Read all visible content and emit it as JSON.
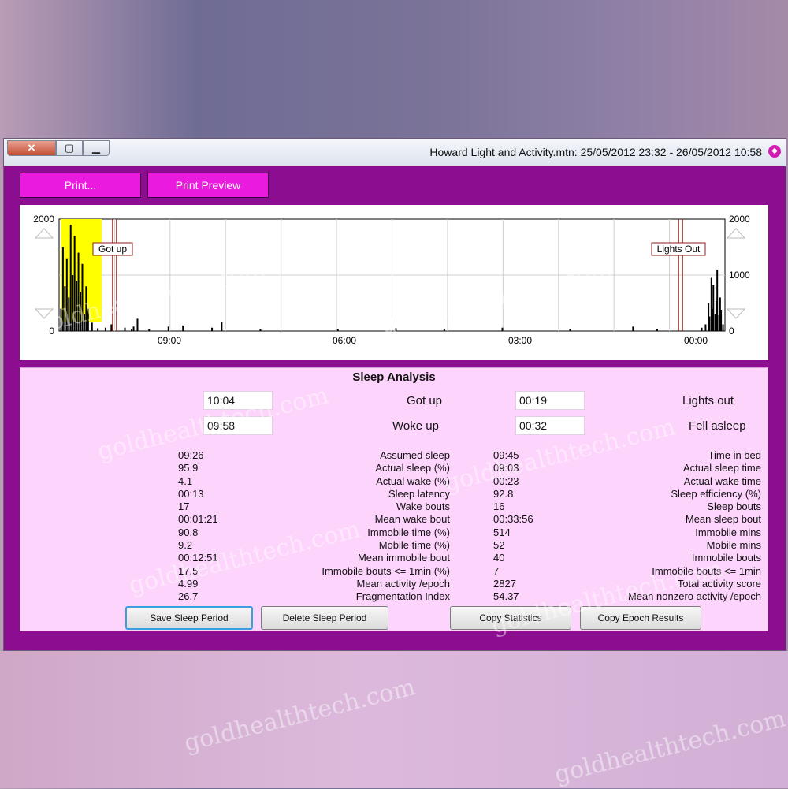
{
  "window": {
    "title": "Howard Light and Activity.mtn: 25/05/2012 23:32 - 26/05/2012 10:58",
    "close_glyph": "✕",
    "max_glyph": "▢",
    "min_glyph": "▁"
  },
  "toolbar": {
    "print_label": "Print...",
    "preview_label": "Print Preview"
  },
  "chart_data": {
    "type": "bar",
    "title": "",
    "x_axis_ticks": [
      "09:00",
      "06:00",
      "03:00",
      "00:00"
    ],
    "y_axis_left_ticks": [
      "2000",
      "0"
    ],
    "y_axis_right_ticks": [
      "2000",
      "1000",
      "0"
    ],
    "ylim": [
      0,
      2000
    ],
    "markers": [
      {
        "label": "Got up",
        "time": "10:04"
      },
      {
        "label": "Lights Out",
        "time": "00:19"
      }
    ],
    "bars": [
      {
        "offset_min": 2,
        "value": 120
      },
      {
        "offset_min": 4,
        "value": 380
      },
      {
        "offset_min": 5,
        "value": 600
      },
      {
        "offset_min": 6,
        "value": 280
      },
      {
        "offset_min": 8,
        "value": 1100
      },
      {
        "offset_min": 9,
        "value": 540
      },
      {
        "offset_min": 10,
        "value": 300
      },
      {
        "offset_min": 12,
        "value": 820
      },
      {
        "offset_min": 13,
        "value": 400
      },
      {
        "offset_min": 14,
        "value": 950
      },
      {
        "offset_min": 16,
        "value": 260
      },
      {
        "offset_min": 17,
        "value": 500
      },
      {
        "offset_min": 20,
        "value": 120
      },
      {
        "offset_min": 24,
        "value": 60
      },
      {
        "offset_min": 70,
        "value": 40
      },
      {
        "offset_min": 95,
        "value": 80
      },
      {
        "offset_min": 160,
        "value": 40
      },
      {
        "offset_min": 230,
        "value": 60
      },
      {
        "offset_min": 290,
        "value": 30
      },
      {
        "offset_min": 340,
        "value": 50
      },
      {
        "offset_min": 400,
        "value": 40
      },
      {
        "offset_min": 480,
        "value": 30
      },
      {
        "offset_min": 520,
        "value": 160
      },
      {
        "offset_min": 530,
        "value": 60
      },
      {
        "offset_min": 560,
        "value": 100
      },
      {
        "offset_min": 575,
        "value": 80
      },
      {
        "offset_min": 595,
        "value": 30
      },
      {
        "offset_min": 607,
        "value": 220
      },
      {
        "offset_min": 611,
        "value": 80
      },
      {
        "offset_min": 613,
        "value": 30
      },
      {
        "offset_min": 620,
        "value": 60
      },
      {
        "offset_min": 634,
        "value": 120
      },
      {
        "offset_min": 640,
        "value": 60
      },
      {
        "offset_min": 648,
        "value": 50
      },
      {
        "offset_min": 654,
        "value": 150
      },
      {
        "offset_min": 658,
        "value": 400
      },
      {
        "offset_min": 660,
        "value": 800
      },
      {
        "offset_min": 662,
        "value": 300
      },
      {
        "offset_min": 664,
        "value": 1200
      },
      {
        "offset_min": 666,
        "value": 700
      },
      {
        "offset_min": 668,
        "value": 1400
      },
      {
        "offset_min": 670,
        "value": 900
      },
      {
        "offset_min": 672,
        "value": 1700
      },
      {
        "offset_min": 674,
        "value": 1000
      },
      {
        "offset_min": 676,
        "value": 1900
      },
      {
        "offset_min": 678,
        "value": 600
      },
      {
        "offset_min": 680,
        "value": 1300
      },
      {
        "offset_min": 682,
        "value": 800
      },
      {
        "offset_min": 684,
        "value": 1500
      },
      {
        "offset_min": 686,
        "value": 400
      }
    ],
    "highlight_regions": [
      {
        "from_min": 0,
        "to_min": 14,
        "kind": "awake-after-lights-out"
      },
      {
        "from_min": 644,
        "to_min": 686,
        "kind": "awake-after-waking",
        "color": "#ffff00"
      }
    ],
    "colors": {
      "bar": "#000000",
      "marker": "#8b1d1d",
      "grid": "#d0d0d0",
      "highlight": "#ffff00"
    }
  },
  "analysis": {
    "title": "Sleep Analysis",
    "lights_out": {
      "label": "Lights out",
      "value": "00:19"
    },
    "got_up": {
      "label": "Got up",
      "value": "10:04"
    },
    "fell_asleep": {
      "label": "Fell asleep",
      "value": "00:32"
    },
    "woke_up": {
      "label": "Woke up",
      "value": "09:58"
    },
    "left_stats": [
      {
        "label": "Time in bed",
        "value": "09:45"
      },
      {
        "label": "Actual sleep time",
        "value": "09:03"
      },
      {
        "label": "Actual wake time",
        "value": "00:23"
      },
      {
        "label": "Sleep efficiency (%)",
        "value": "92.8"
      },
      {
        "label": "Sleep bouts",
        "value": "16"
      },
      {
        "label": "Mean sleep bout",
        "value": "00:33:56"
      },
      {
        "label": "Immobile mins",
        "value": "514"
      },
      {
        "label": "Mobile mins",
        "value": "52"
      },
      {
        "label": "Immobile bouts",
        "value": "40"
      },
      {
        "label": "Immobile bouts <= 1min",
        "value": "7"
      },
      {
        "label": "Total activity score",
        "value": "2827"
      },
      {
        "label": "Mean nonzero activity /epoch",
        "value": "54.37"
      }
    ],
    "right_stats": [
      {
        "label": "Assumed sleep",
        "value": "09:26"
      },
      {
        "label": "Actual sleep (%)",
        "value": "95.9"
      },
      {
        "label": "Actual wake (%)",
        "value": "4.1"
      },
      {
        "label": "Sleep latency",
        "value": "00:13"
      },
      {
        "label": "Wake bouts",
        "value": "17"
      },
      {
        "label": "Mean wake bout",
        "value": "00:01:21"
      },
      {
        "label": "Immobile time (%)",
        "value": "90.8"
      },
      {
        "label": "Mobile time (%)",
        "value": "9.2"
      },
      {
        "label": "Mean immobile bout",
        "value": "00:12:51"
      },
      {
        "label": "Immobile bouts <= 1min (%)",
        "value": "17.5"
      },
      {
        "label": "Mean activity /epoch",
        "value": "4.99"
      },
      {
        "label": "Fragmentation Index",
        "value": "26.7"
      }
    ],
    "buttons": {
      "copy_epoch": "Copy Epoch Results",
      "copy_stats": "Copy Statistics",
      "delete_period": "Delete Sleep Period",
      "save_period": "Save Sleep Period"
    }
  },
  "watermark": "goldhealthtech.com"
}
